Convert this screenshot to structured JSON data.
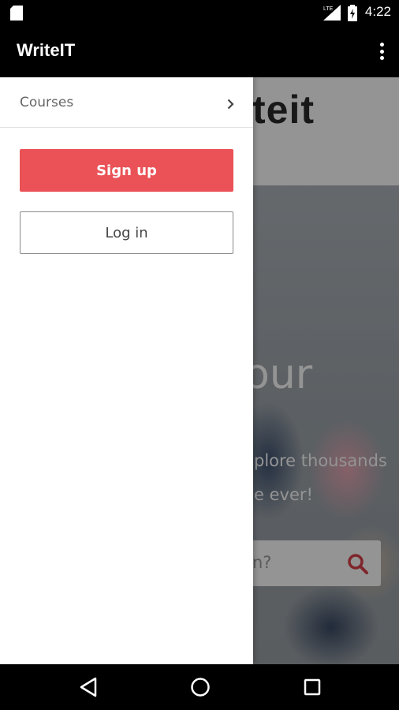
{
  "status_bar": {
    "time": "4:22",
    "network": "LTE",
    "icons": [
      "sd-card-icon",
      "signal-icon",
      "battery-icon"
    ]
  },
  "app_bar": {
    "title": "WriteIT",
    "menu_icon": "more-vert-icon"
  },
  "drawer": {
    "courses_label": "Courses",
    "courses_icon": "chevron-right-icon",
    "signup_label": "Sign up",
    "login_label": "Log in"
  },
  "background_page": {
    "logo_fragment": "teit",
    "hero_word_fragment": "our",
    "hero_sub_line1": "plore thousands",
    "hero_sub_line2": "e ever!",
    "search_placeholder_fragment": "n?",
    "search_icon": "search-icon"
  },
  "nav_bar": {
    "icons": [
      "back-icon",
      "home-icon",
      "recents-icon"
    ]
  },
  "colors": {
    "app_bar": "#000000",
    "accent": "#ea5257",
    "drawer_bg": "#ffffff",
    "search_icon": "#d9434b"
  }
}
